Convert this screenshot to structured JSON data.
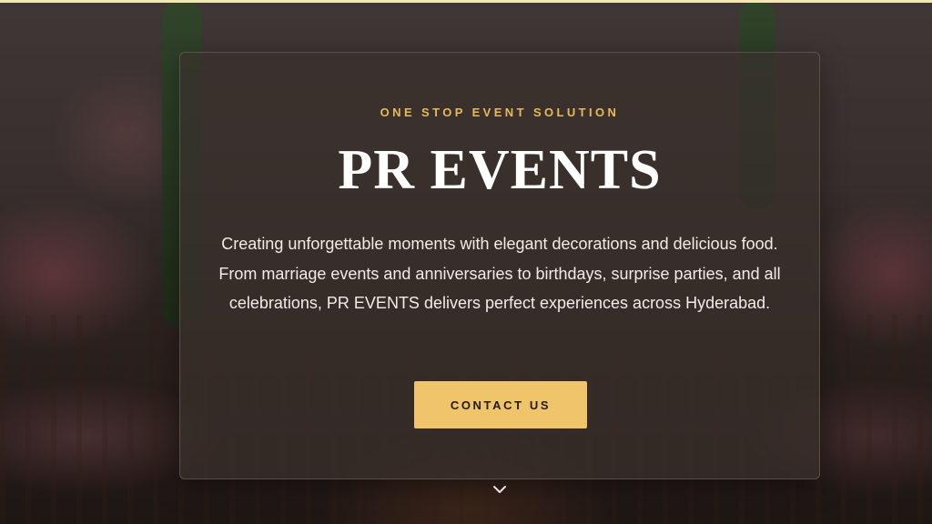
{
  "hero": {
    "tagline": "ONE STOP EVENT SOLUTION",
    "title": "PR EVENTS",
    "description": "Creating unforgettable moments with elegant decorations and delicious food. From marriage events and anniversaries to birthdays, surprise parties, and all celebrations, PR EVENTS delivers perfect experiences across Hyderabad.",
    "cta_label": "CONTACT US",
    "scroll_icon": "chevron-down-icon"
  },
  "colors": {
    "accent": "#f0c46a",
    "tagline": "#e6b95e",
    "title": "#ffffff",
    "text": "#f1ece8",
    "top_line": "#f3e7b4"
  }
}
